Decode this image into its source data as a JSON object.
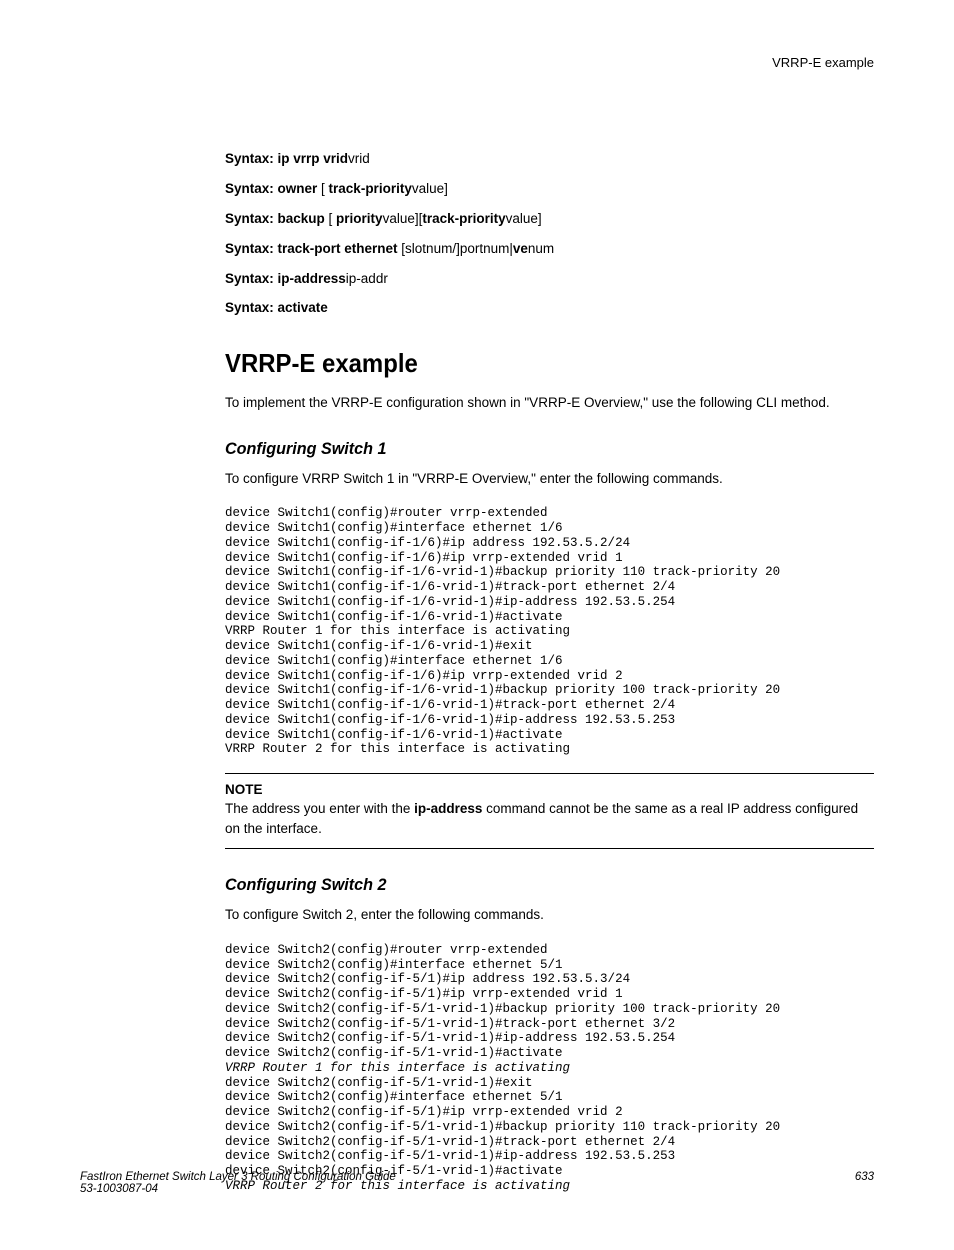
{
  "header": {
    "topic": "VRRP-E example"
  },
  "syntax": {
    "l1_b1": "Syntax: ip vrrp vrid",
    "l1_t1": "vrid",
    "l2_b1": "Syntax: owner",
    "l2_t1": " [ ",
    "l2_b2": "track-priority",
    "l2_t2": "value]",
    "l3_b1": "Syntax: backup",
    "l3_t1": " [ ",
    "l3_b2": "priority",
    "l3_t2": "value][",
    "l3_b3": "track-priority",
    "l3_t3": "value]",
    "l4_b1": "Syntax: track-port ethernet",
    "l4_t1": " [slotnum/]portnum|",
    "l4_b2": "ve",
    "l4_t2": "num",
    "l5_b1": "Syntax: ip-address",
    "l5_t1": "ip-addr",
    "l6_b1": "Syntax: activate"
  },
  "section": {
    "title": "VRRP-E example",
    "intro": "To implement the VRRP-E configuration shown in \"VRRP-E Overview,\" use the following CLI method."
  },
  "sub1": {
    "title": "Configuring Switch 1",
    "intro": "To configure VRRP Switch 1 in \"VRRP-E Overview,\" enter the following commands.",
    "code": "device Switch1(config)#router vrrp-extended\ndevice Switch1(config)#interface ethernet 1/6\ndevice Switch1(config-if-1/6)#ip address 192.53.5.2/24\ndevice Switch1(config-if-1/6)#ip vrrp-extended vrid 1\ndevice Switch1(config-if-1/6-vrid-1)#backup priority 110 track-priority 20\ndevice Switch1(config-if-1/6-vrid-1)#track-port ethernet 2/4\ndevice Switch1(config-if-1/6-vrid-1)#ip-address 192.53.5.254\ndevice Switch1(config-if-1/6-vrid-1)#activate\nVRRP Router 1 for this interface is activating\ndevice Switch1(config-if-1/6-vrid-1)#exit\ndevice Switch1(config)#interface ethernet 1/6\ndevice Switch1(config-if-1/6)#ip vrrp-extended vrid 2\ndevice Switch1(config-if-1/6-vrid-1)#backup priority 100 track-priority 20\ndevice Switch1(config-if-1/6-vrid-1)#track-port ethernet 2/4\ndevice Switch1(config-if-1/6-vrid-1)#ip-address 192.53.5.253\ndevice Switch1(config-if-1/6-vrid-1)#activate\nVRRP Router 2 for this interface is activating"
  },
  "note": {
    "label": "NOTE",
    "t1": "The address you enter with the ",
    "b1": "ip-address",
    "t2": " command cannot be the same as a real IP address configured on the interface."
  },
  "sub2": {
    "title": "Configuring Switch 2",
    "intro": "To configure Switch 2, enter the following commands.",
    "code_plain1": "device Switch2(config)#router vrrp-extended\ndevice Switch2(config)#interface ethernet 5/1\ndevice Switch2(config-if-5/1)#ip address 192.53.5.3/24\ndevice Switch2(config-if-5/1)#ip vrrp-extended vrid 1\ndevice Switch2(config-if-5/1-vrid-1)#backup priority 100 track-priority 20\ndevice Switch2(config-if-5/1-vrid-1)#track-port ethernet 3/2\ndevice Switch2(config-if-5/1-vrid-1)#ip-address 192.53.5.254\ndevice Switch2(config-if-5/1-vrid-1)#activate",
    "code_ital1": "VRRP Router 1 for this interface is activating",
    "code_plain2": "device Switch2(config-if-5/1-vrid-1)#exit\ndevice Switch2(config)#interface ethernet 5/1\ndevice Switch2(config-if-5/1)#ip vrrp-extended vrid 2\ndevice Switch2(config-if-5/1-vrid-1)#backup priority 110 track-priority 20\ndevice Switch2(config-if-5/1-vrid-1)#track-port ethernet 2/4\ndevice Switch2(config-if-5/1-vrid-1)#ip-address 192.53.5.253\ndevice Switch2(config-if-5/1-vrid-1)#activate",
    "code_ital2": "VRRP Router 2 for this interface is activating"
  },
  "footer": {
    "title": "FastIron Ethernet Switch Layer 3 Routing Configuration Guide",
    "docnum": "53-1003087-04",
    "pagenum": "633"
  }
}
